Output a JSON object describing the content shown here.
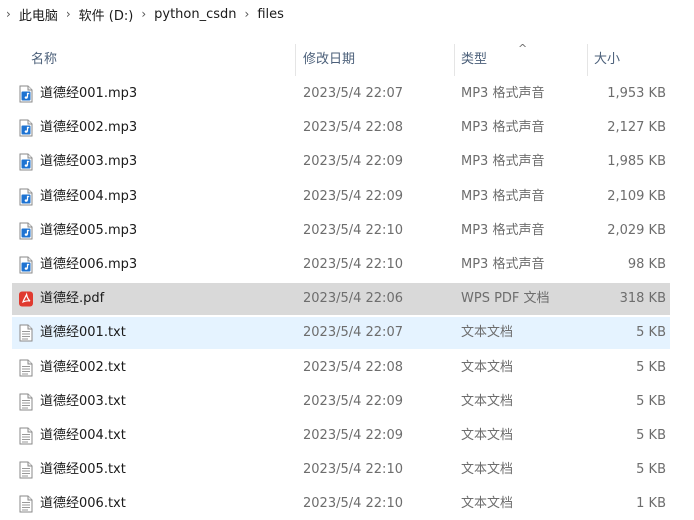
{
  "breadcrumb": [
    "此电脑",
    "软件 (D:)",
    "python_csdn",
    "files"
  ],
  "columns": {
    "name": "名称",
    "date": "修改日期",
    "type": "类型",
    "size": "大小"
  },
  "files": [
    {
      "name": "道德经001.mp3",
      "date": "2023/5/4 22:07",
      "type": "MP3 格式声音",
      "size": "1,953 KB",
      "icon": "audio-file-icon",
      "state": ""
    },
    {
      "name": "道德经002.mp3",
      "date": "2023/5/4 22:08",
      "type": "MP3 格式声音",
      "size": "2,127 KB",
      "icon": "audio-file-icon",
      "state": ""
    },
    {
      "name": "道德经003.mp3",
      "date": "2023/5/4 22:09",
      "type": "MP3 格式声音",
      "size": "1,985 KB",
      "icon": "audio-file-icon",
      "state": ""
    },
    {
      "name": "道德经004.mp3",
      "date": "2023/5/4 22:09",
      "type": "MP3 格式声音",
      "size": "2,109 KB",
      "icon": "audio-file-icon",
      "state": ""
    },
    {
      "name": "道德经005.mp3",
      "date": "2023/5/4 22:10",
      "type": "MP3 格式声音",
      "size": "2,029 KB",
      "icon": "audio-file-icon",
      "state": ""
    },
    {
      "name": "道德经006.mp3",
      "date": "2023/5/4 22:10",
      "type": "MP3 格式声音",
      "size": "98 KB",
      "icon": "audio-file-icon",
      "state": ""
    },
    {
      "name": "道德经.pdf",
      "date": "2023/5/4 22:06",
      "type": "WPS PDF 文档",
      "size": "318 KB",
      "icon": "pdf-file-icon",
      "state": "selected"
    },
    {
      "name": "道德经001.txt",
      "date": "2023/5/4 22:07",
      "type": "文本文档",
      "size": "5 KB",
      "icon": "text-file-icon",
      "state": "hover"
    },
    {
      "name": "道德经002.txt",
      "date": "2023/5/4 22:08",
      "type": "文本文档",
      "size": "5 KB",
      "icon": "text-file-icon",
      "state": ""
    },
    {
      "name": "道德经003.txt",
      "date": "2023/5/4 22:09",
      "type": "文本文档",
      "size": "5 KB",
      "icon": "text-file-icon",
      "state": ""
    },
    {
      "name": "道德经004.txt",
      "date": "2023/5/4 22:09",
      "type": "文本文档",
      "size": "5 KB",
      "icon": "text-file-icon",
      "state": ""
    },
    {
      "name": "道德经005.txt",
      "date": "2023/5/4 22:10",
      "type": "文本文档",
      "size": "5 KB",
      "icon": "text-file-icon",
      "state": ""
    },
    {
      "name": "道德经006.txt",
      "date": "2023/5/4 22:10",
      "type": "文本文档",
      "size": "1 KB",
      "icon": "text-file-icon",
      "state": ""
    }
  ],
  "colors": {
    "selected": "#d9d9d9",
    "hover": "#e5f3ff",
    "header_text": "#4c607a",
    "audio_icon": "#1e73d2",
    "pdf_icon": "#e03a2f"
  }
}
